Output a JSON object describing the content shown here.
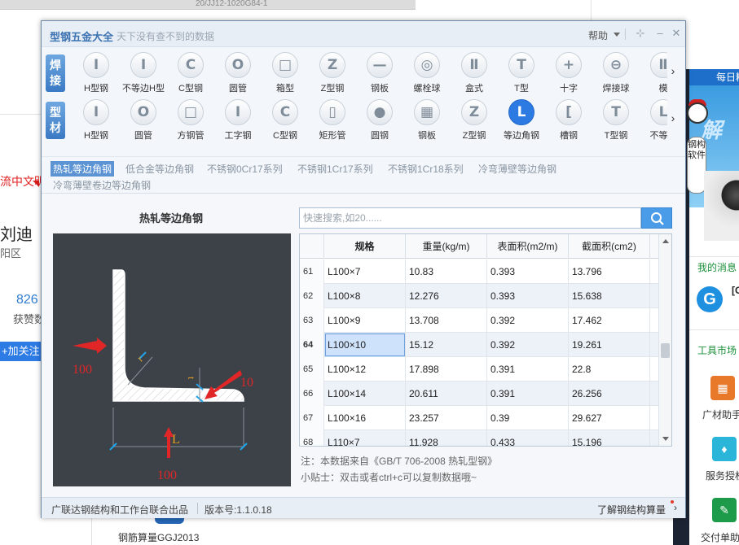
{
  "background": {
    "top_strip_text": "20/JJ12-1020G84-1",
    "red_text": "流中文明",
    "name": "刘迪",
    "area": "阳区",
    "count": "826",
    "praise_label": "获赞数",
    "follow_button": "+加关注",
    "bottom_item": "钢筋算量GGJ2013",
    "right_panel": {
      "header": "每日精",
      "banner_text": "解",
      "scroll_text": "钢构软件",
      "messages": "我的消息",
      "bracket": "[C",
      "tools_heading": "工具市场",
      "tools": [
        "广材助手",
        "服务授权",
        "交付单助"
      ]
    }
  },
  "window": {
    "title": "型钢五金大全",
    "subtitle": "天下没有查不到的数据",
    "help": "帮助",
    "controls": {
      "pin": "⊹",
      "minimize": "–",
      "close": "✕"
    }
  },
  "categories": {
    "weld": {
      "badge_top": "焊",
      "badge_bottom": "接",
      "items": [
        {
          "label": "H型钢",
          "icon": "h-beam-icon",
          "glyph": "Ⅰ"
        },
        {
          "label": "不等边H型",
          "icon": "unequal-h-beam-icon",
          "glyph": "Ⅰ"
        },
        {
          "label": "C型钢",
          "icon": "c-channel-icon",
          "glyph": "C"
        },
        {
          "label": "圆管",
          "icon": "round-tube-icon",
          "glyph": "O"
        },
        {
          "label": "箱型",
          "icon": "box-section-icon",
          "glyph": "□"
        },
        {
          "label": "Z型钢",
          "icon": "z-section-icon",
          "glyph": "Z"
        },
        {
          "label": "钢板",
          "icon": "steel-plate-icon",
          "glyph": "—"
        },
        {
          "label": "螺栓球",
          "icon": "bolt-ball-icon",
          "glyph": "◎"
        },
        {
          "label": "盒式",
          "icon": "box-type-icon",
          "glyph": "Ⅱ"
        },
        {
          "label": "T型",
          "icon": "t-section-icon",
          "glyph": "T"
        },
        {
          "label": "十字",
          "icon": "cross-section-icon",
          "glyph": "+"
        },
        {
          "label": "焊接球",
          "icon": "welded-ball-icon",
          "glyph": "⊖"
        },
        {
          "label": "模",
          "icon": "misc-section-icon",
          "glyph": "Ⅱ"
        }
      ]
    },
    "section": {
      "badge_top": "型",
      "badge_bottom": "材",
      "items": [
        {
          "label": "H型钢",
          "icon": "h-beam-icon",
          "glyph": "Ⅰ"
        },
        {
          "label": "圆管",
          "icon": "round-tube-icon",
          "glyph": "O"
        },
        {
          "label": "方钢管",
          "icon": "square-tube-icon",
          "glyph": "□"
        },
        {
          "label": "工字钢",
          "icon": "i-beam-icon",
          "glyph": "Ⅰ"
        },
        {
          "label": "C型钢",
          "icon": "c-channel-icon",
          "glyph": "C"
        },
        {
          "label": "矩形管",
          "icon": "rect-tube-icon",
          "glyph": "▯"
        },
        {
          "label": "圆钢",
          "icon": "round-bar-icon",
          "glyph": "●"
        },
        {
          "label": "钢板",
          "icon": "steel-plate-icon",
          "glyph": "▦"
        },
        {
          "label": "Z型钢",
          "icon": "z-section-icon",
          "glyph": "Z"
        },
        {
          "label": "等边角钢",
          "icon": "equal-angle-icon",
          "glyph": "L"
        },
        {
          "label": "槽钢",
          "icon": "channel-icon",
          "glyph": "["
        },
        {
          "label": "T型钢",
          "icon": "t-section-icon",
          "glyph": "T"
        },
        {
          "label": "不等边",
          "icon": "unequal-angle-icon",
          "glyph": "L"
        }
      ]
    }
  },
  "subtabs": [
    "热轧等边角钢",
    "低合金等边角钢",
    "不锈钢0Cr17系列",
    "不锈钢1Cr17系列",
    "不锈钢1Cr18系列",
    "冷弯薄壁等边角钢",
    "冷弯薄壁卷边等边角钢"
  ],
  "detail": {
    "title": "热轧等边角钢",
    "dim_left": "100",
    "dim_bottom": "100",
    "dim_thickness": "10",
    "letter_L": "L",
    "letter_r": "r",
    "letter_t": "t"
  },
  "search": {
    "placeholder": "快速搜索,如20......",
    "value": ""
  },
  "table": {
    "columns": [
      "规格",
      "重量(kg/m)",
      "表面积(m2/m)",
      "截面积(cm2)"
    ],
    "rows": [
      {
        "n": "61",
        "spec": "L100×7",
        "weight": "10.83",
        "surface": "0.393",
        "area": "13.796"
      },
      {
        "n": "62",
        "spec": "L100×8",
        "weight": "12.276",
        "surface": "0.393",
        "area": "15.638"
      },
      {
        "n": "63",
        "spec": "L100×9",
        "weight": "13.708",
        "surface": "0.392",
        "area": "17.462"
      },
      {
        "n": "64",
        "spec": "L100×10",
        "weight": "15.12",
        "surface": "0.392",
        "area": "19.261"
      },
      {
        "n": "65",
        "spec": "L100×12",
        "weight": "17.898",
        "surface": "0.391",
        "area": "22.8"
      },
      {
        "n": "66",
        "spec": "L100×14",
        "weight": "20.611",
        "surface": "0.391",
        "area": "26.256"
      },
      {
        "n": "67",
        "spec": "L100×16",
        "weight": "23.257",
        "surface": "0.39",
        "area": "29.627"
      },
      {
        "n": "68",
        "spec": "L110×7",
        "weight": "11.928",
        "surface": "0.433",
        "area": "15.196"
      }
    ]
  },
  "notes": {
    "source": "注：本数据来自《GB/T  706-2008  热轧型钢》",
    "tip": "小贴士：双击或者ctrl+c可以复制数据哦~"
  },
  "status": {
    "left": "广联达钢结构和工作台联合出品",
    "version": "版本号:1.1.0.18",
    "right": "了解钢结构算量"
  }
}
